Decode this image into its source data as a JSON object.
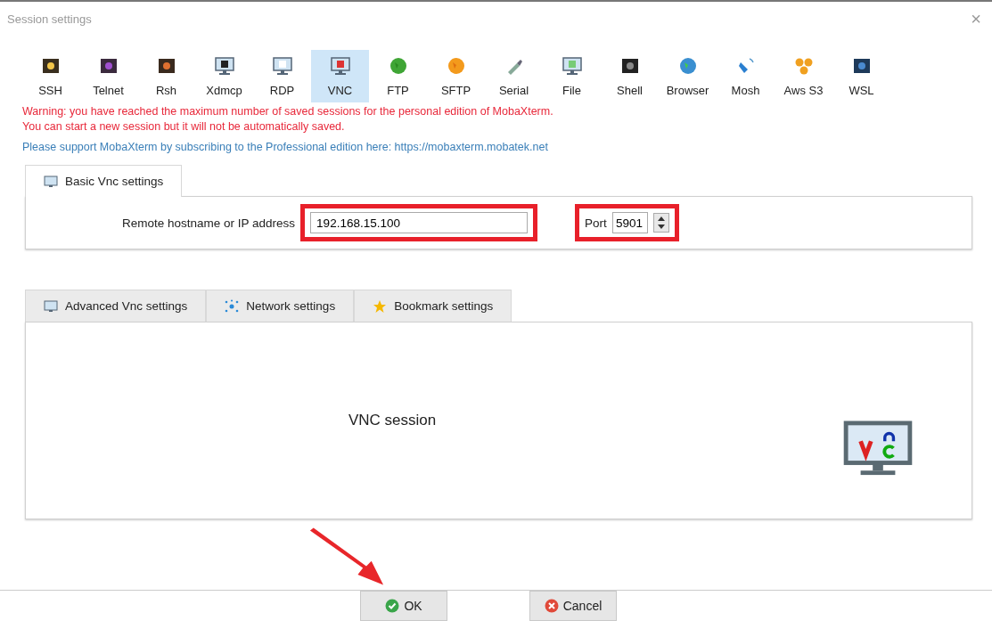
{
  "window": {
    "title": "Session settings",
    "close": "×"
  },
  "session_types": [
    {
      "label": "SSH",
      "selected": false
    },
    {
      "label": "Telnet",
      "selected": false
    },
    {
      "label": "Rsh",
      "selected": false
    },
    {
      "label": "Xdmcp",
      "selected": false
    },
    {
      "label": "RDP",
      "selected": false
    },
    {
      "label": "VNC",
      "selected": true
    },
    {
      "label": "FTP",
      "selected": false
    },
    {
      "label": "SFTP",
      "selected": false
    },
    {
      "label": "Serial",
      "selected": false
    },
    {
      "label": "File",
      "selected": false
    },
    {
      "label": "Shell",
      "selected": false
    },
    {
      "label": "Browser",
      "selected": false
    },
    {
      "label": "Mosh",
      "selected": false
    },
    {
      "label": "Aws S3",
      "selected": false
    },
    {
      "label": "WSL",
      "selected": false
    }
  ],
  "warnings": [
    "Warning: you have reached the maximum number of saved sessions for the personal edition of MobaXterm.",
    "You can start a new session but it will not be automatically saved."
  ],
  "support_note": "Please support MobaXterm by subscribing to the Professional edition here: https://mobaxterm.mobatek.net",
  "basic_tab": {
    "label": "Basic Vnc settings",
    "selected": true
  },
  "host": {
    "label": "Remote hostname or IP address",
    "value": "192.168.15.100",
    "highlighted": true
  },
  "port": {
    "label": "Port",
    "value": "5901",
    "highlighted": true
  },
  "advanced_tabs": [
    {
      "label": "Advanced Vnc settings",
      "selected": false
    },
    {
      "label": "Network settings",
      "selected": false
    },
    {
      "label": "Bookmark settings",
      "selected": false
    }
  ],
  "session_caption": "VNC session",
  "buttons": [
    {
      "kind": "ok",
      "label": "OK",
      "pointed_at": true
    },
    {
      "kind": "cancel",
      "label": "Cancel",
      "pointed_at": false
    }
  ]
}
